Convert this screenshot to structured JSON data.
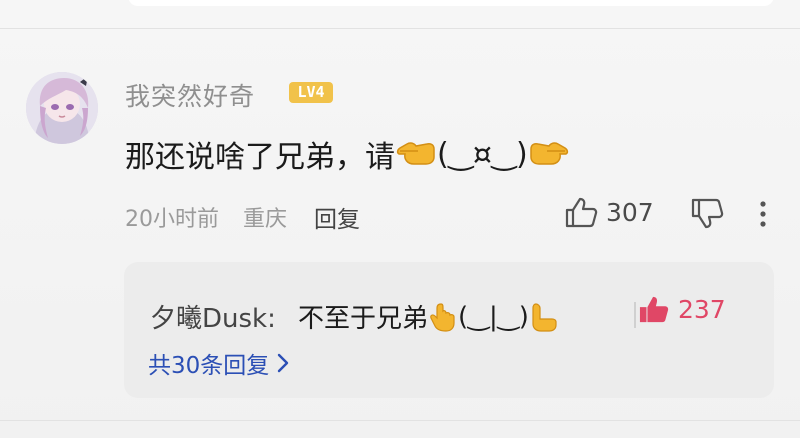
{
  "comment": {
    "username": "我突然好奇",
    "level_badge": "LV4",
    "text_before": "那还说啥了兄弟，请",
    "text_middle": "(‿¤‿)",
    "time": "20小时前",
    "location": "重庆",
    "reply_label": "回复",
    "like_count": "307"
  },
  "reply_preview": {
    "username": "夕曦Dusk:",
    "text_before": "不至于兄弟",
    "text_middle": "(‿|‿)",
    "like_count": "237",
    "view_all_label": "共30条回复"
  },
  "colors": {
    "level_badge": "#f1c24a",
    "like_active": "#e04766",
    "link": "#2b4fb5"
  }
}
